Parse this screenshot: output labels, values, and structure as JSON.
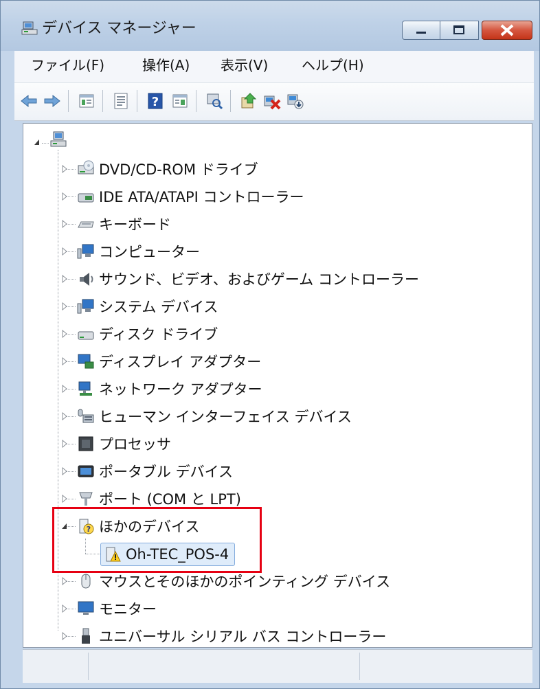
{
  "window": {
    "title": "デバイス マネージャー"
  },
  "menu": [
    "ファイル(F)",
    "操作(A)",
    "表示(V)",
    "ヘルプ(H)"
  ],
  "toolbar": [
    "back-arrow-icon",
    "forward-arrow-icon",
    "properties-icon",
    "details-icon",
    "help-icon",
    "view-icon",
    "scan-hardware-icon",
    "update-driver-icon",
    "uninstall-icon",
    "disable-icon"
  ],
  "tree": {
    "root_label": "",
    "categories": [
      {
        "label": "DVD/CD-ROM ドライブ",
        "icon": "dvd-drive-icon"
      },
      {
        "label": "IDE ATA/ATAPI コントローラー",
        "icon": "ide-controller-icon"
      },
      {
        "label": "キーボード",
        "icon": "keyboard-icon"
      },
      {
        "label": "コンピューター",
        "icon": "computer-icon"
      },
      {
        "label": "サウンド、ビデオ、およびゲーム コントローラー",
        "icon": "speaker-icon"
      },
      {
        "label": "システム デバイス",
        "icon": "system-device-icon"
      },
      {
        "label": "ディスク ドライブ",
        "icon": "disk-drive-icon"
      },
      {
        "label": "ディスプレイ アダプター",
        "icon": "display-adapter-icon"
      },
      {
        "label": "ネットワーク アダプター",
        "icon": "network-adapter-icon"
      },
      {
        "label": "ヒューマン インターフェイス デバイス",
        "icon": "hid-icon"
      },
      {
        "label": "プロセッサ",
        "icon": "processor-icon"
      },
      {
        "label": "ポータブル デバイス",
        "icon": "portable-device-icon"
      },
      {
        "label": "ポート (COM と LPT)",
        "icon": "port-icon"
      },
      {
        "label": "ほかのデバイス",
        "icon": "unknown-device-icon",
        "expanded": true,
        "children": [
          {
            "label": "Oh-TEC_POS-4",
            "icon": "warning-device-icon",
            "selected": true
          }
        ]
      },
      {
        "label": "マウスとそのほかのポインティング デバイス",
        "icon": "mouse-icon"
      },
      {
        "label": "モニター",
        "icon": "monitor-icon"
      },
      {
        "label": "ユニバーサル シリアル バス コントローラー",
        "icon": "usb-icon"
      }
    ]
  },
  "colors": {
    "highlight": "#e60012",
    "selection": "#dfecfa"
  }
}
